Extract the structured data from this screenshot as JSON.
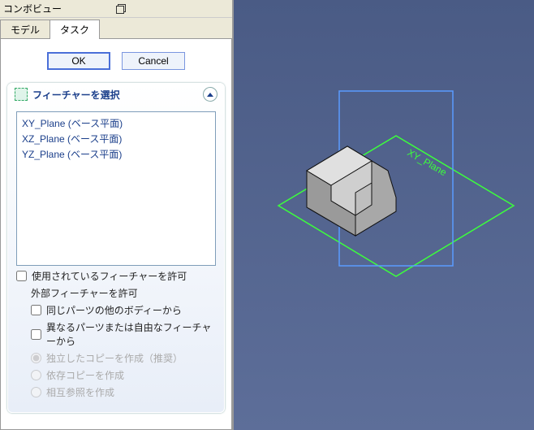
{
  "panel": {
    "title": "コンボビュー",
    "tabs": {
      "model": "モデル",
      "task": "タスク",
      "active": "task"
    },
    "buttons": {
      "ok": "OK",
      "cancel": "Cancel"
    },
    "task": {
      "header": "フィーチャーを選択",
      "planes": [
        "XY_Plane (ベース平面)",
        "XZ_Plane (ベース平面)",
        "YZ_Plane (ベース平面)"
      ],
      "allow_used": "使用されているフィーチャーを許可",
      "allow_external": "外部フィーチャーを許可",
      "from_other_bodies_same_part": "同じパーツの他のボディーから",
      "from_different_parts_free": "異なるパーツまたは自由なフィーチャーから",
      "radio_independent": "独立したコピーを作成（推奨）",
      "radio_dependent": "依存コピーを作成",
      "radio_crossref": "相互参照を作成"
    }
  }
}
